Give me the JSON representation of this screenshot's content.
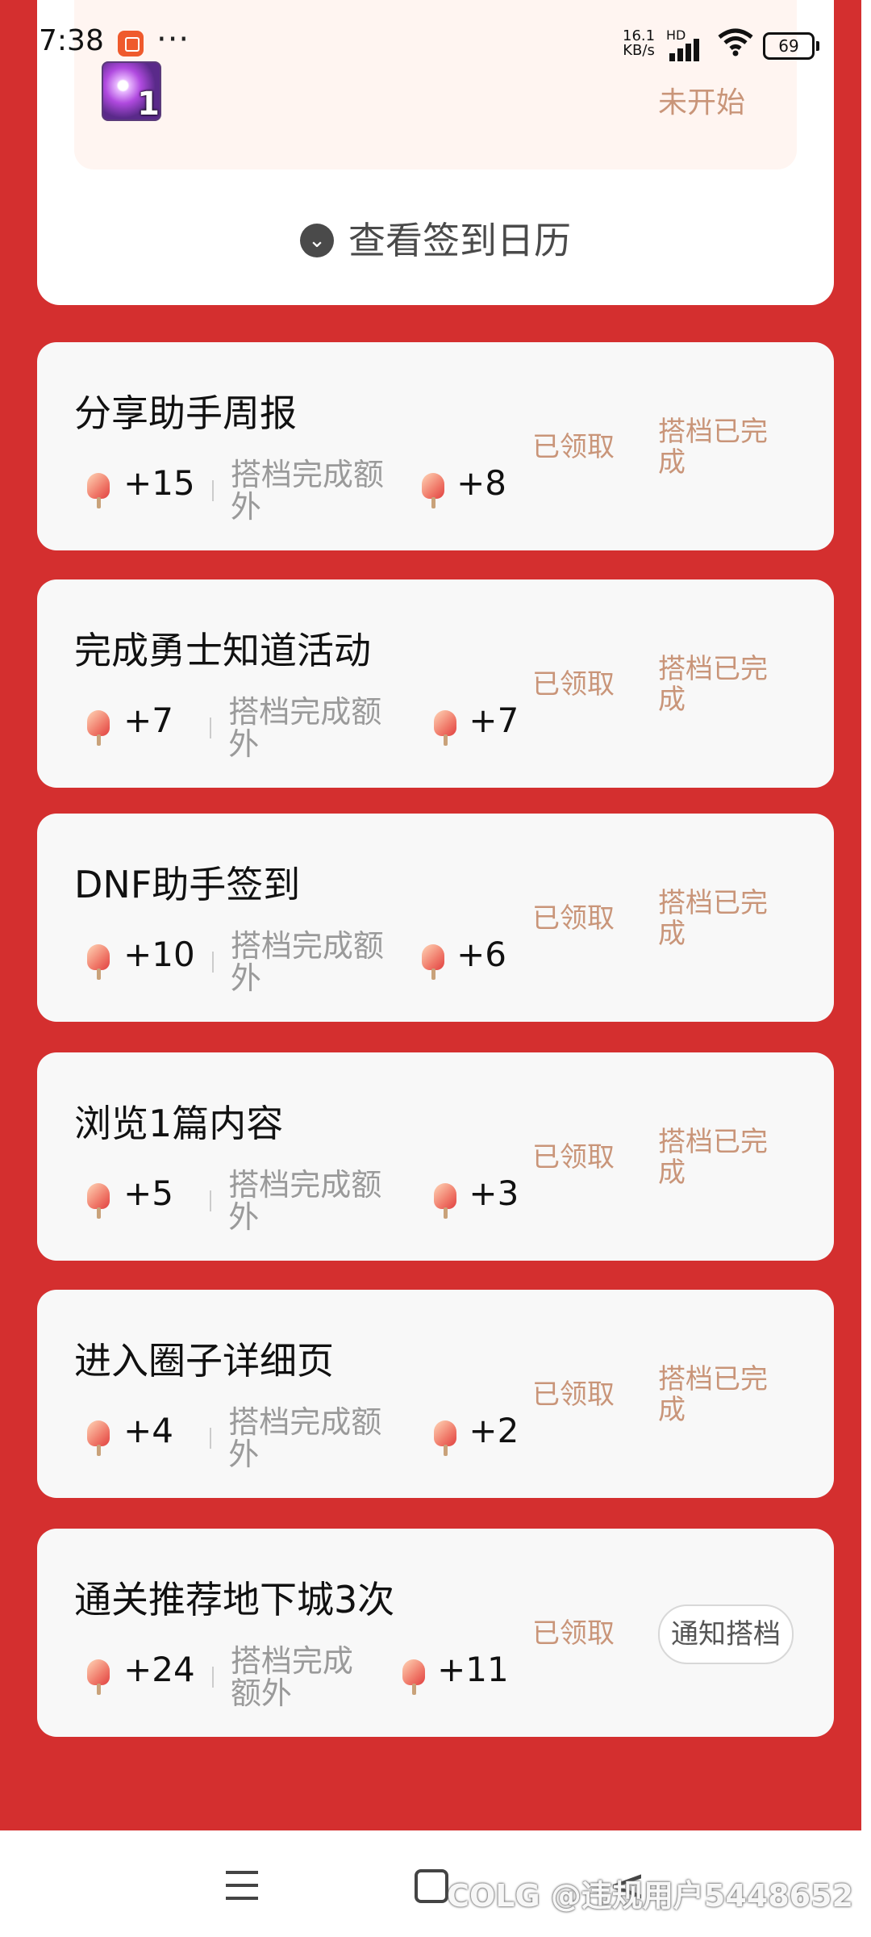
{
  "status_bar": {
    "time": "7:38",
    "more": "···",
    "net_speed": "16.1",
    "net_unit": "KB/s",
    "signal_label": "HD",
    "battery": "69"
  },
  "top_section": {
    "avatar_badge": "1",
    "status": "未开始",
    "calendar_link": "查看签到日历"
  },
  "tasks": [
    {
      "title": "分享助手周报",
      "points": "+15",
      "extra_label": "搭档完成额外",
      "extra_points": "+8",
      "claimed": "已领取",
      "partner_status": "搭档已完成"
    },
    {
      "title": "完成勇士知道活动",
      "points": "+7",
      "extra_label": "搭档完成额外",
      "extra_points": "+7",
      "claimed": "已领取",
      "partner_status": "搭档已完成"
    },
    {
      "title": "DNF助手签到",
      "points": "+10",
      "extra_label": "搭档完成额外",
      "extra_points": "+6",
      "claimed": "已领取",
      "partner_status": "搭档已完成"
    },
    {
      "title": "浏览1篇内容",
      "points": "+5",
      "extra_label": "搭档完成额外",
      "extra_points": "+3",
      "claimed": "已领取",
      "partner_status": "搭档已完成"
    },
    {
      "title": "进入圈子详细页",
      "points": "+4",
      "extra_label": "搭档完成额外",
      "extra_points": "+2",
      "claimed": "已领取",
      "partner_status": "搭档已完成"
    },
    {
      "title": "通关推荐地下城3次",
      "points": "+24",
      "extra_label": "搭档完成额外",
      "extra_points": "+11",
      "claimed": "已领取",
      "partner_action": "通知搭档"
    }
  ],
  "watermark": "COLG @违规用户5448652",
  "colors": {
    "accent_red": "#d42f2f",
    "muted_orange": "#c99579"
  }
}
